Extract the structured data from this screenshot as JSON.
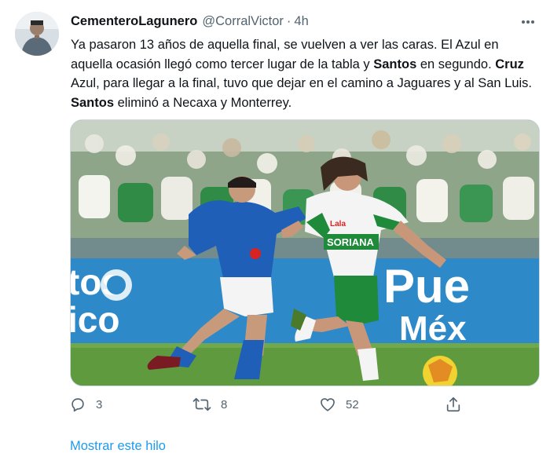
{
  "tweet": {
    "author": {
      "name": "CementeroLagunero",
      "handle": "@CorralVictor",
      "time": "4h"
    },
    "text": {
      "p1": "Ya pasaron 13 años de aquella final, se vuelven a ver las caras. El Azul en aquella ocasión llegó como tercer lugar de la tabla y ",
      "b1": "Santos",
      "p2": " en segundo. ",
      "b2": "Cruz",
      "p3": " Azul, para llegar a la final, tuvo que dejar en el camino a Jaguares y al San Luis. ",
      "b3": "Santos",
      "p4": " eliminó a Necaxa y Monterrey."
    },
    "media": {
      "banner_left_line1": "tos",
      "banner_left_line2": "ico",
      "banner_right_line1": "Pue",
      "banner_right_line2": "Méx",
      "jersey_text": "SORIANA",
      "jersey_text2": "Lala"
    },
    "actions": {
      "reply_count": "3",
      "retweet_count": "8",
      "like_count": "52"
    },
    "show_thread": "Mostrar este hilo"
  },
  "icons": {
    "more": "more-icon",
    "reply": "reply-icon",
    "retweet": "retweet-icon",
    "like": "like-icon",
    "share": "share-icon"
  },
  "colors": {
    "text": "#0f1419",
    "secondary": "#536471",
    "link": "#1d9bf0",
    "cruz_azul": "#1f5fb8",
    "santos_green": "#1e8a3a"
  }
}
